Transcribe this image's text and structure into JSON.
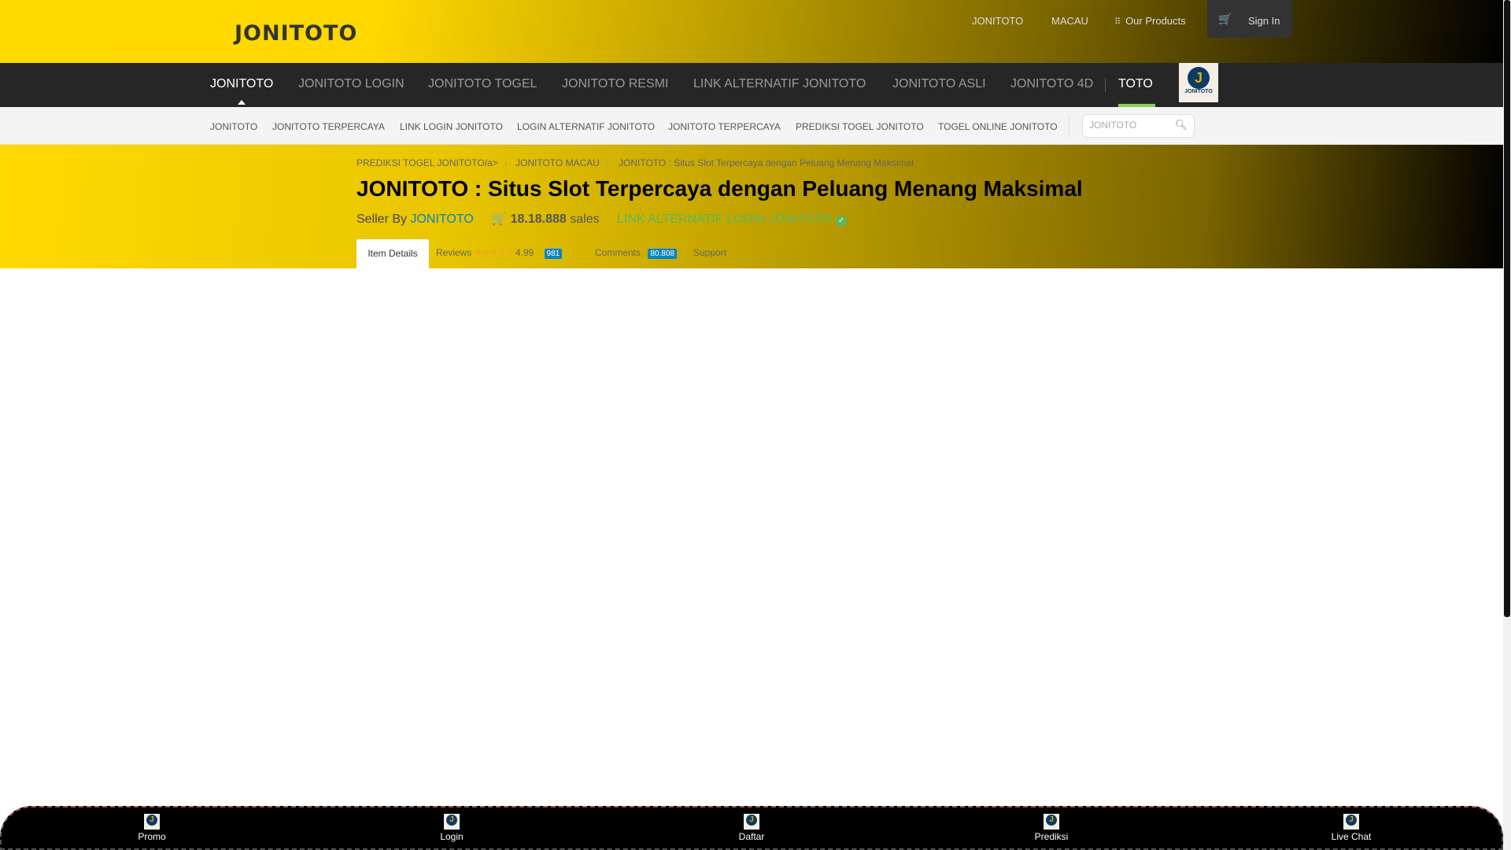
{
  "header": {
    "logo": "JONITOTO",
    "links": [
      "JONITOTO",
      "MACAU",
      "Our Products"
    ],
    "sign_in": "Sign In"
  },
  "nav": {
    "items": [
      "JONITOTO",
      "JONITOTO LOGIN",
      "JONITOTO TOGEL",
      "JONITOTO RESMI",
      "LINK ALTERNATIF JONITOTO",
      "JONITOTO ASLI",
      "JONITOTO 4D",
      "TOTO"
    ],
    "badge_logo": "JONITOTO"
  },
  "subnav": {
    "items": [
      "JONITOTO",
      "JONITOTO TERPERCAYA",
      "LINK LOGIN JONITOTO",
      "LOGIN ALTERNATIF JONITOTO",
      "JONITOTO TERPERCAYA",
      "PREDIKSI TOGEL JONITOTO",
      "TOGEL ONLINE JONITOTO"
    ],
    "search_placeholder": "JONITOTO"
  },
  "breadcrumb": [
    "PREDIKSI TOGEL JONITOTO/a>",
    "JONITOTO MACAU",
    "JONITOTO : Situs Slot Terpercaya dengan Peluang Menang Maksimal"
  ],
  "title": "JONITOTO : Situs Slot Terpercaya dengan Peluang Menang Maksimal",
  "seller": {
    "prefix": "Seller By",
    "name": "JONITOTO",
    "sales_count": "18.18.888",
    "sales_label": "sales",
    "link": "LINK ALTERNATIF LOGIN JONITOTO"
  },
  "tabs": {
    "item_details": "Item Details",
    "reviews": "Reviews",
    "rating": "4.99",
    "review_count": "981",
    "comments": "Comments",
    "comment_count": "80.808",
    "support": "Support"
  },
  "bottom": [
    "Promo",
    "Login",
    "Daftar",
    "Prediksi",
    "Live Chat"
  ],
  "colors": {
    "accent": "#ffda00",
    "nav": "#262626",
    "link": "#0a84c4",
    "green": "#5cb85c"
  }
}
